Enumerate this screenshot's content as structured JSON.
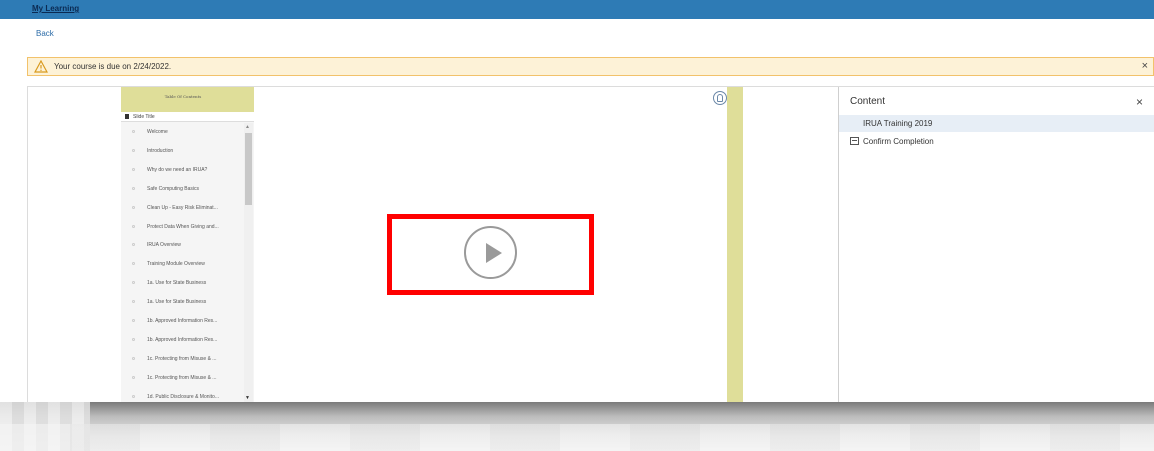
{
  "topbar": {
    "title": "My Learning",
    "color": "#2e7bb5"
  },
  "nav": {
    "back_label": "Back"
  },
  "alert": {
    "message": "Your course is due on 2/24/2022.",
    "close": "×"
  },
  "toc": {
    "title": "Table Of Contents",
    "course_title": "Slide Title",
    "items": [
      "Welcome",
      "Introduction",
      "Why do we need an IRUA?",
      "Safe Computing Basics",
      "Clean Up - Easy Risk Eliminat...",
      "Protect Data When Giving and...",
      "IRUA Overview",
      "Training Module Overview",
      "1a. Use for State Business",
      "1a. Use for State Business",
      "1b. Approved Information Res...",
      "1b. Approved Information Res...",
      "1c. Protecting from Misuse & ...",
      "1c. Protecting from Misuse & ...",
      "1d. Public Disclosure & Monito..."
    ]
  },
  "content_panel": {
    "title": "Content",
    "close": "×",
    "selected_item": "IRUA Training 2019",
    "confirm_label": "Confirm Completion"
  },
  "colors": {
    "player_frame": "#dfde99",
    "highlight": "#ff0000",
    "alert_bg": "#fdf2d7"
  }
}
